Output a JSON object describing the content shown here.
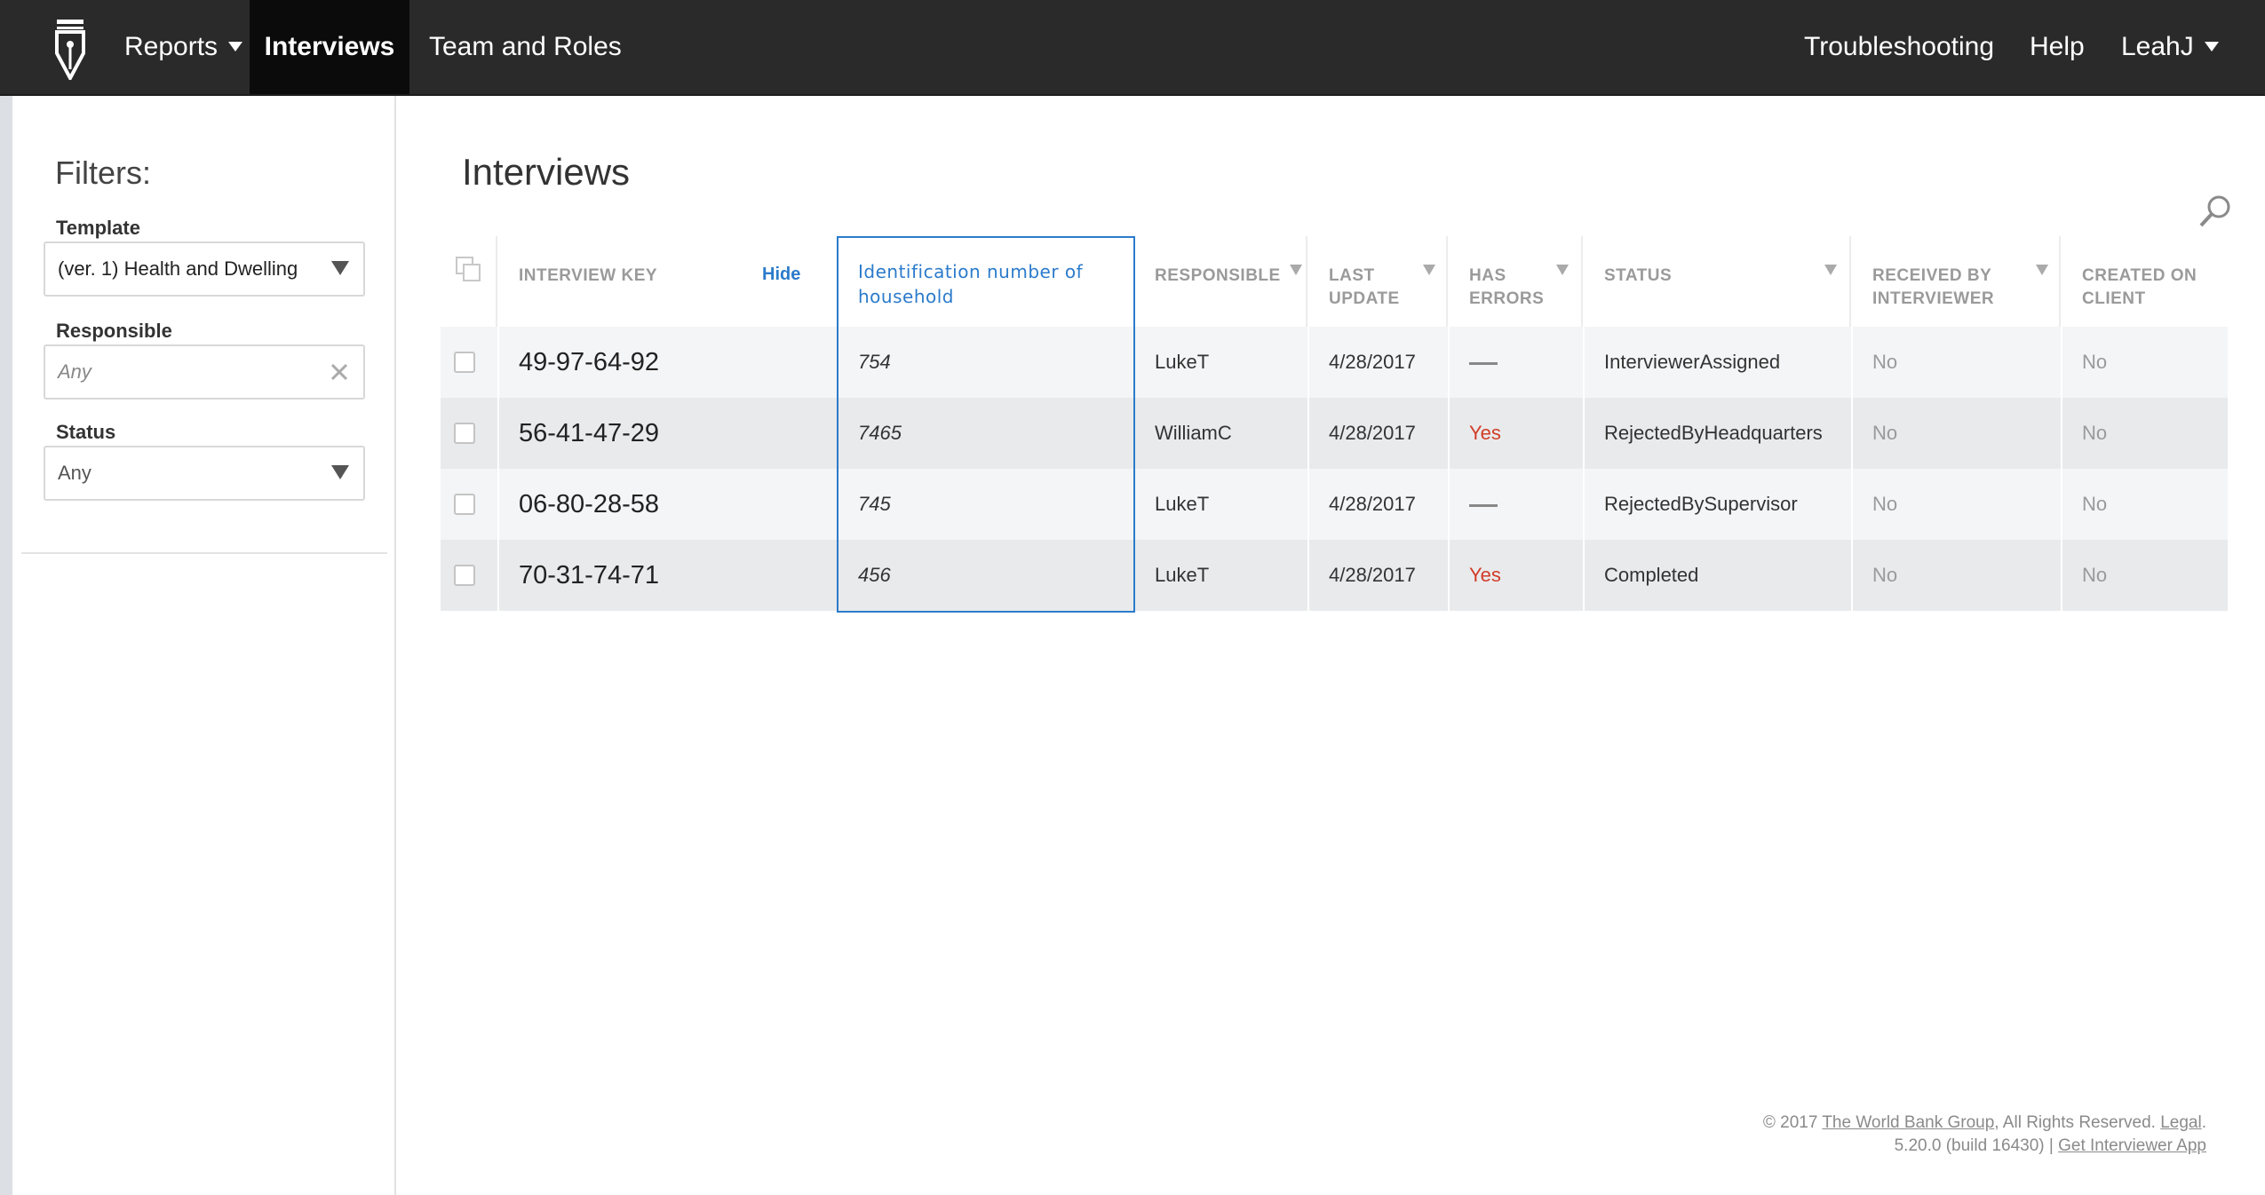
{
  "nav": {
    "logo_icon": "pen-nib-logo-icon",
    "items": [
      {
        "label": "Reports",
        "has_caret": true
      },
      {
        "label": "Interviews",
        "active": true
      },
      {
        "label": "Team and Roles"
      }
    ],
    "right_items": [
      {
        "label": "Troubleshooting"
      },
      {
        "label": "Help"
      },
      {
        "label": "LeahJ",
        "has_caret": true
      }
    ]
  },
  "sidebar": {
    "title": "Filters:",
    "template": {
      "label": "Template",
      "value": "(ver. 1) Health and Dwelling"
    },
    "responsible": {
      "label": "Responsible",
      "placeholder": "Any"
    },
    "status": {
      "label": "Status",
      "value": "Any"
    }
  },
  "main": {
    "title": "Interviews",
    "columns": {
      "interview_key": "INTERVIEW KEY",
      "hide": "Hide",
      "id_number": "Identification number of household",
      "responsible": "RESPONSIBLE",
      "last_update_1": "LAST",
      "last_update_2": "UPDATE",
      "has_errors_1": "HAS",
      "has_errors_2": "ERRORS",
      "status": "STATUS",
      "received_1": "RECEIVED BY",
      "received_2": "INTERVIEWER",
      "created_1": "CREATED ON",
      "created_2": "CLIENT"
    },
    "rows": [
      {
        "key": "49-97-64-92",
        "id": "754",
        "responsible": "LukeT",
        "last_update": "4/28/2017",
        "has_errors": "",
        "status": "InterviewerAssigned",
        "received": "No",
        "created": "No"
      },
      {
        "key": "56-41-47-29",
        "id": "7465",
        "responsible": "WilliamC",
        "last_update": "4/28/2017",
        "has_errors": "Yes",
        "status": "RejectedByHeadquarters",
        "received": "No",
        "created": "No"
      },
      {
        "key": "06-80-28-58",
        "id": "745",
        "responsible": "LukeT",
        "last_update": "4/28/2017",
        "has_errors": "",
        "status": "RejectedBySupervisor",
        "received": "No",
        "created": "No"
      },
      {
        "key": "70-31-74-71",
        "id": "456",
        "responsible": "LukeT",
        "last_update": "4/28/2017",
        "has_errors": "Yes",
        "status": "Completed",
        "received": "No",
        "created": "No"
      }
    ]
  },
  "footer": {
    "copyright": "© 2017 ",
    "org_link": "The World Bank Group",
    "rights": ", All Rights Reserved. ",
    "legal_link": "Legal",
    "period": ".",
    "version": "5.20.0 (build 16430) | ",
    "app_link": "Get Interviewer App"
  },
  "colors": {
    "nav_bg": "#2a2a2a",
    "nav_active_bg": "#0b0b0b",
    "accent_blue": "#2b7bcb",
    "error_red": "#d23c28"
  }
}
